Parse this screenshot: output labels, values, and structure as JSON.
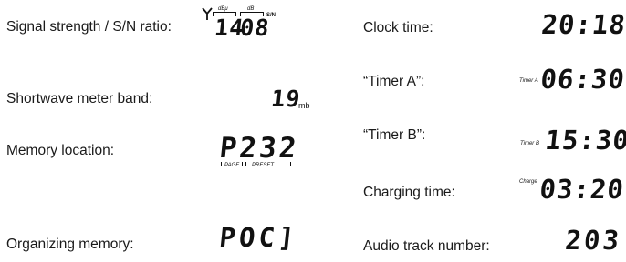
{
  "left": {
    "signal": {
      "label": "Signal strength / S/N ratio:",
      "dbu": "dBμ",
      "db": "dB",
      "value_a": "14",
      "value_b": "08",
      "sn": "S/N"
    },
    "band": {
      "label": "Shortwave meter band:",
      "value": "19",
      "unit": "mb"
    },
    "memory": {
      "label": "Memory location:",
      "value": "P232",
      "page": "PAGE",
      "preset": "PRESET"
    },
    "organizing": {
      "label": "Organizing memory:",
      "value": "POC]"
    }
  },
  "right": {
    "clock": {
      "label": "Clock time:",
      "value": "20:18"
    },
    "timer_a": {
      "label": "“Timer A”:",
      "tag": "Timer A",
      "value": "06:30"
    },
    "timer_b": {
      "label": "“Timer B”:",
      "tag": "Timer B",
      "value": "15:30"
    },
    "charging": {
      "label": "Charging time:",
      "tag": "Charge",
      "value": "03:20"
    },
    "track": {
      "label": "Audio track number:",
      "value": "203"
    }
  }
}
